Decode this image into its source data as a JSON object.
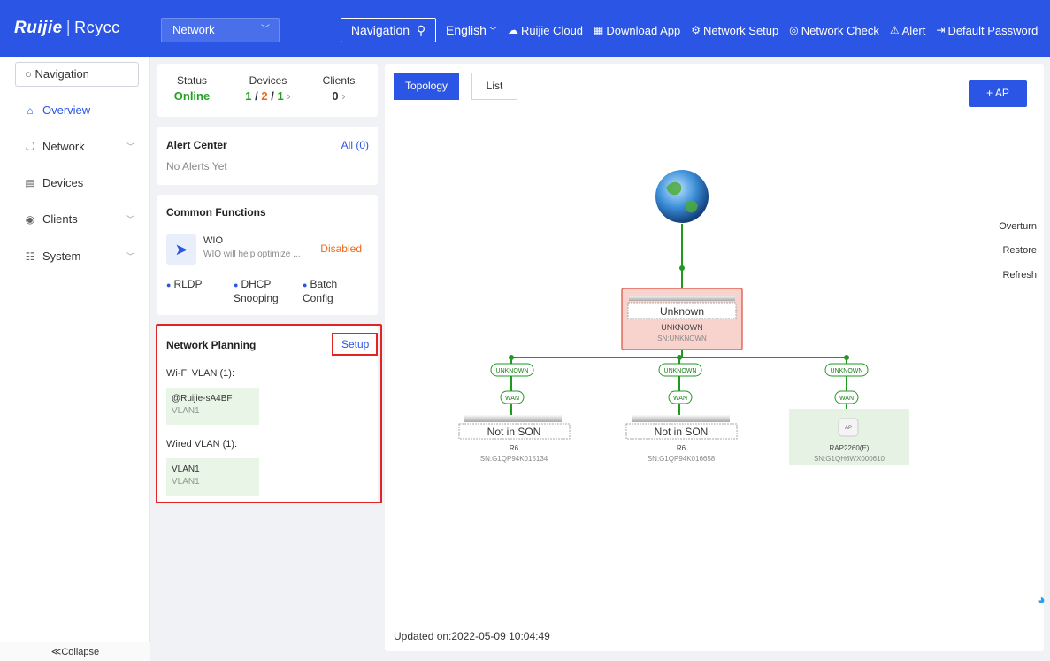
{
  "header": {
    "logo_brand": "Ruijie",
    "logo_separator": "|",
    "logo_sub": "Rcycc",
    "network_select": "Network",
    "navigation_label": "Navigation",
    "language": "English",
    "menu": [
      {
        "label": "Ruijie Cloud",
        "icon": "cloud-icon"
      },
      {
        "label": "Download App",
        "icon": "qr-code-icon"
      },
      {
        "label": "Network Setup",
        "icon": "network-setup-icon"
      },
      {
        "label": "Network Check",
        "icon": "network-check-icon"
      },
      {
        "label": "Alert",
        "icon": "alert-icon"
      },
      {
        "label": "Default Password",
        "icon": "logout-icon"
      }
    ]
  },
  "sidebar": {
    "search_label": "Navigation",
    "items": [
      {
        "label": "Overview",
        "icon": "home-icon",
        "active": true
      },
      {
        "label": "Network",
        "icon": "network-icon"
      },
      {
        "label": "Devices",
        "icon": "devices-icon"
      },
      {
        "label": "Clients",
        "icon": "clients-icon"
      },
      {
        "label": "System",
        "icon": "system-icon"
      }
    ],
    "collapse_label": "≪Collapse"
  },
  "status_card": {
    "status_label": "Status",
    "status_value": "Online",
    "devices_label": "Devices",
    "devices_a": "1",
    "devices_b": "2",
    "devices_c": "1",
    "slash": "/",
    "clients_label": "Clients",
    "clients_value": "0"
  },
  "alert_card": {
    "title": "Alert Center",
    "all_link": "All (0)",
    "empty_text": "No Alerts Yet"
  },
  "common_functions": {
    "title": "Common Functions",
    "wio_name": "WIO",
    "wio_desc": "WIO will help optimize ...",
    "wio_status": "Disabled",
    "items": [
      "RLDP",
      "DHCP Snooping",
      "Batch Config"
    ]
  },
  "network_planning": {
    "title": "Network Planning",
    "setup_link": "Setup",
    "wifi_vlan_label": "Wi-Fi VLAN (1):",
    "wifi_vlan_ssid": "@Ruijie-sA4BF",
    "wifi_vlan_id": "VLAN1",
    "wired_vlan_label": "Wired VLAN (1):",
    "wired_vlan_name": "VLAN1",
    "wired_vlan_id": "VLAN1"
  },
  "topology": {
    "tabs": [
      "Topology",
      "List"
    ],
    "add_ap_label": "+ AP",
    "side_actions": [
      "Overturn",
      "Restore",
      "Refresh"
    ],
    "root_device": {
      "box": "Unknown",
      "model": "UNKNOWN",
      "sn": "SN:UNKNOWN"
    },
    "children": [
      {
        "port": "UNKNOWN",
        "wan": "WAN",
        "box": "Not in SON",
        "model": "R6",
        "sn": "SN:G1QP94K015134"
      },
      {
        "port": "UNKNOWN",
        "wan": "WAN",
        "box": "Not in SON",
        "model": "R6",
        "sn": "SN:G1QP94K016658"
      },
      {
        "port": "UNKNOWN",
        "wan": "WAN",
        "box": "AP",
        "model": "RAP2260(E)",
        "sn": "SN:G1QH6WX000610"
      }
    ],
    "updated": "Updated on:2022-05-09 10:04:49"
  },
  "colors": {
    "brand": "#2a55e5",
    "online": "#23a01f",
    "warning": "#e96a18",
    "highlight": "#e32424",
    "topology_line": "#1f9a1f"
  }
}
